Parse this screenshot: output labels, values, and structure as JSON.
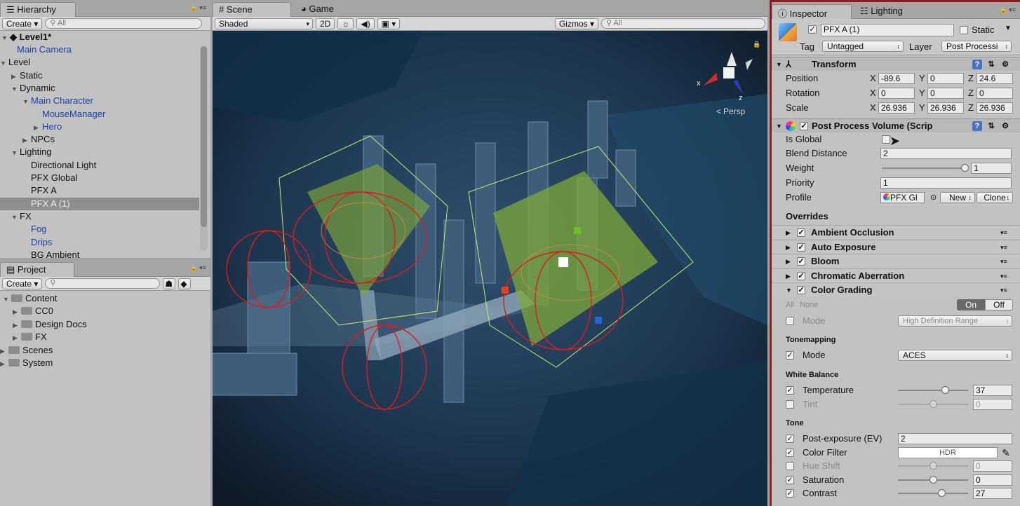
{
  "hierarchy": {
    "tab": "Hierarchy",
    "create": "Create",
    "search_placeholder": "All",
    "scene_name": "Level1*",
    "items": [
      {
        "label": "Main Camera",
        "blue": true
      },
      {
        "label": "Level",
        "blue": false
      },
      {
        "label": "Static",
        "blue": false
      },
      {
        "label": "Dynamic",
        "blue": false
      },
      {
        "label": "Main Character",
        "blue": true
      },
      {
        "label": "MouseManager",
        "blue": true
      },
      {
        "label": "Hero",
        "blue": true
      },
      {
        "label": "NPCs",
        "blue": false
      },
      {
        "label": "Lighting",
        "blue": false
      },
      {
        "label": "Directional Light",
        "blue": false
      },
      {
        "label": "PFX Global",
        "blue": false
      },
      {
        "label": "PFX A",
        "blue": false
      },
      {
        "label": "PFX A (1)",
        "blue": false
      },
      {
        "label": "FX",
        "blue": false
      },
      {
        "label": "Fog",
        "blue": true
      },
      {
        "label": "Drips",
        "blue": true
      },
      {
        "label": "BG Ambient",
        "blue": false
      }
    ]
  },
  "project": {
    "tab": "Project",
    "create": "Create",
    "items": [
      "Content",
      "CC0",
      "Design Docs",
      "FX",
      "Scenes",
      "System"
    ]
  },
  "scene": {
    "tab_scene": "Scene",
    "tab_game": "Game",
    "shading": "Shaded",
    "mode_2d": "2D",
    "gizmos": "Gizmos",
    "search_placeholder": "All",
    "persp": "Persp",
    "axis_x": "x",
    "axis_z": "z"
  },
  "inspector": {
    "tab": "Inspector",
    "tab_lighting": "Lighting",
    "object_name": "PFX A (1)",
    "static_label": "Static",
    "tag_label": "Tag",
    "tag_value": "Untagged",
    "layer_label": "Layer",
    "layer_value": "Post Processi",
    "transform": {
      "title": "Transform",
      "position_label": "Position",
      "rotation_label": "Rotation",
      "scale_label": "Scale",
      "position": [
        "-89.6",
        "0",
        "24.6"
      ],
      "rotation": [
        "0",
        "0",
        "0"
      ],
      "scale": [
        "26.936",
        "26.936",
        "26.936"
      ],
      "x": "X",
      "y": "Y",
      "z": "Z"
    },
    "ppv": {
      "title": "Post Process Volume (Scrip",
      "is_global": "Is Global",
      "blend_distance": "Blend Distance",
      "blend_value": "2",
      "weight": "Weight",
      "weight_value": "1",
      "weight_fraction": 1.0,
      "priority": "Priority",
      "priority_value": "1",
      "profile": "Profile",
      "profile_value": "PFX Gl",
      "new_btn": "New",
      "clone_btn": "Clone",
      "overrides": "Overrides",
      "effects": [
        "Ambient Occlusion",
        "Auto Exposure",
        "Bloom",
        "Chromatic Aberration",
        "Color Grading"
      ]
    },
    "grading": {
      "all": "All",
      "none": "None",
      "on": "On",
      "off": "Off",
      "mode_label": "Mode",
      "mode_value": "High Definition Range",
      "tonemapping": "Tonemapping",
      "tm_mode_label": "Mode",
      "tm_mode_value": "ACES",
      "white_balance": "White Balance",
      "temperature": "Temperature",
      "temperature_value": "37",
      "tint": "Tint",
      "tint_value": "0",
      "tone": "Tone",
      "post_exposure": "Post-exposure (EV)",
      "post_exposure_value": "2",
      "color_filter": "Color Filter",
      "color_filter_value": "HDR",
      "hue_shift": "Hue Shift",
      "hue_shift_value": "0",
      "saturation": "Saturation",
      "saturation_value": "0",
      "contrast": "Contrast",
      "contrast_value": "27"
    }
  },
  "colors": {
    "accent_border": "#8c1e1e",
    "blue_text": "#1a3fa8",
    "volume_green": "#7fa83a",
    "gizmo_red": "#e01a1a"
  }
}
